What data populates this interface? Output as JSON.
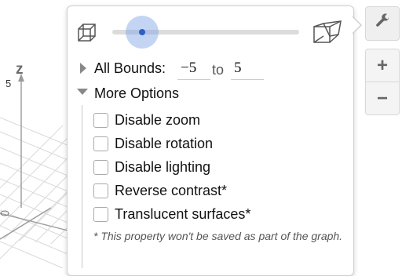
{
  "axis": {
    "z_label": "z",
    "tick_label": "5"
  },
  "popover": {
    "bounds_label": "All Bounds:",
    "bound_min": "−5",
    "bound_to": "to",
    "bound_max": "5",
    "more_options_label": "More Options",
    "slider_value": 0.15,
    "options": [
      {
        "label": "Disable zoom",
        "checked": false
      },
      {
        "label": "Disable rotation",
        "checked": false
      },
      {
        "label": "Disable lighting",
        "checked": false
      },
      {
        "label": "Reverse contrast*",
        "checked": false
      },
      {
        "label": "Translucent surfaces*",
        "checked": false
      }
    ],
    "note": "* This property won't be saved as part of the graph."
  },
  "toolbar": {
    "zoom_in": "+",
    "zoom_out": "−"
  },
  "icons": {
    "left_projection": "orthographic-cube-icon",
    "right_projection": "perspective-cube-icon",
    "settings": "wrench-icon"
  },
  "colors": {
    "slider_accent": "#2f5fc7",
    "slider_halo": "#7da1e6"
  }
}
